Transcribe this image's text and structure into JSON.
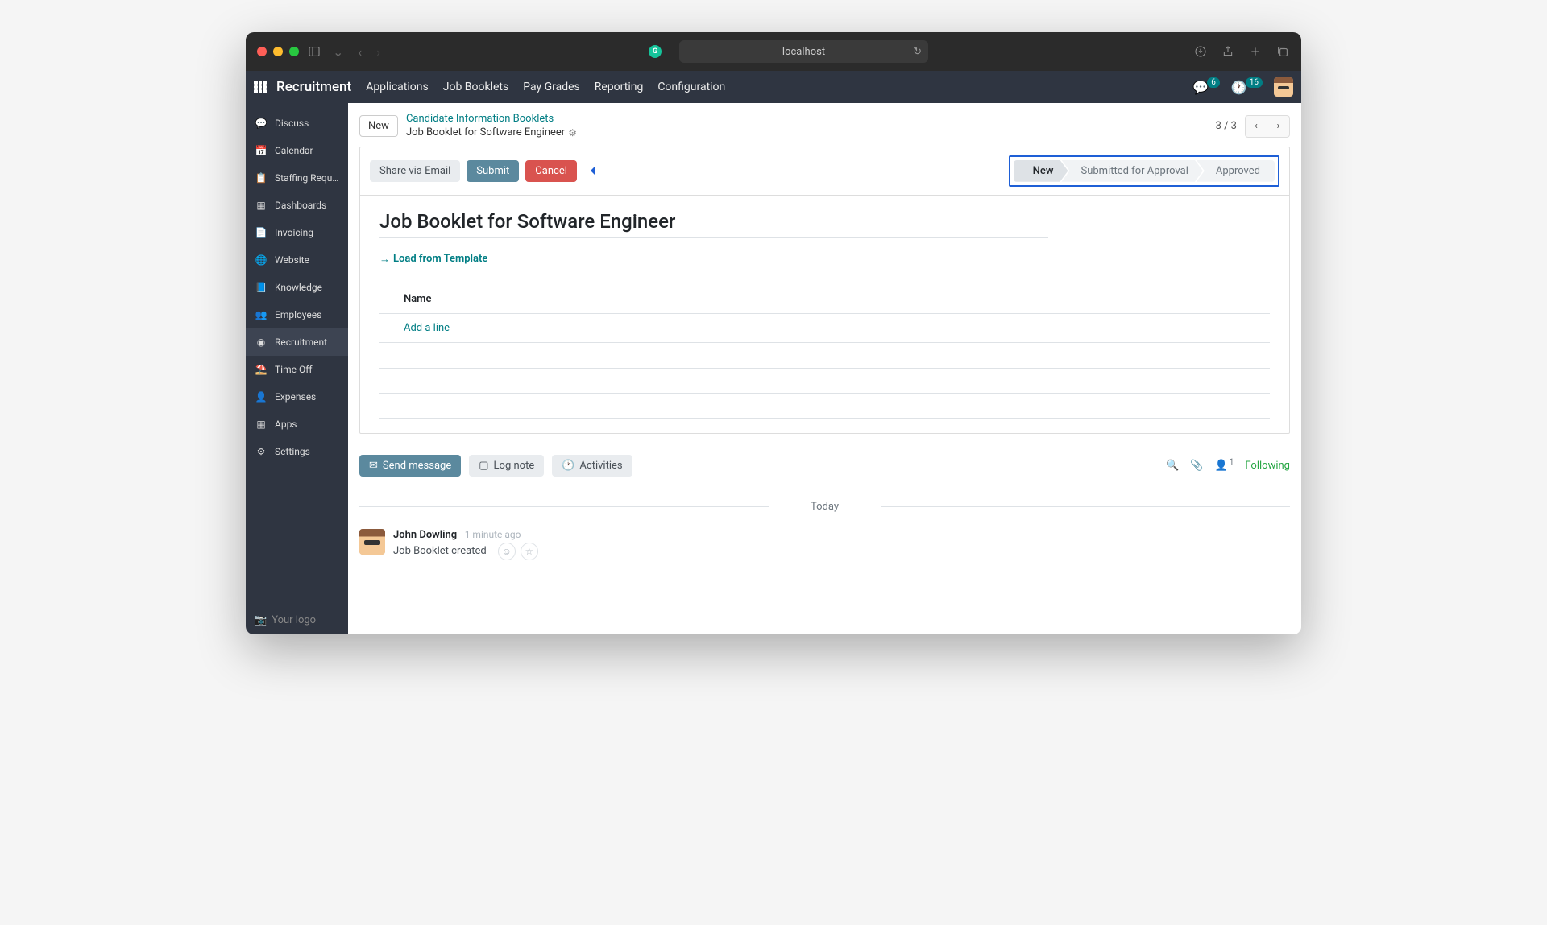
{
  "browser": {
    "url": "localhost"
  },
  "topnav": {
    "brand": "Recruitment",
    "items": [
      "Applications",
      "Job Booklets",
      "Pay Grades",
      "Reporting",
      "Configuration"
    ],
    "chat_badge": "6",
    "activity_badge": "16"
  },
  "sidebar": {
    "items": [
      {
        "label": "Discuss",
        "icon": "chat"
      },
      {
        "label": "Calendar",
        "icon": "calendar"
      },
      {
        "label": "Staffing Requ…",
        "icon": "clipboard"
      },
      {
        "label": "Dashboards",
        "icon": "grid"
      },
      {
        "label": "Invoicing",
        "icon": "invoice"
      },
      {
        "label": "Website",
        "icon": "globe"
      },
      {
        "label": "Knowledge",
        "icon": "book"
      },
      {
        "label": "Employees",
        "icon": "users"
      },
      {
        "label": "Recruitment",
        "icon": "person",
        "active": true
      },
      {
        "label": "Time Off",
        "icon": "umbrella"
      },
      {
        "label": "Expenses",
        "icon": "money"
      },
      {
        "label": "Apps",
        "icon": "apps"
      },
      {
        "label": "Settings",
        "icon": "gear"
      }
    ],
    "footer": "Your logo"
  },
  "breadcrumb": {
    "new_btn": "New",
    "parent": "Candidate Information Booklets",
    "current": "Job Booklet for Software Engineer",
    "pager": "3 / 3"
  },
  "actions": {
    "share": "Share via Email",
    "submit": "Submit",
    "cancel": "Cancel"
  },
  "status": {
    "steps": [
      "New",
      "Submitted for Approval",
      "Approved"
    ],
    "active_index": 0
  },
  "form": {
    "title": "Job Booklet for Software Engineer",
    "load_template": "Load from Template",
    "table_header": "Name",
    "add_line": "Add a line"
  },
  "chatter": {
    "send": "Send message",
    "log": "Log note",
    "activities": "Activities",
    "following": "Following",
    "follower_count": "1"
  },
  "thread": {
    "date": "Today",
    "author": "John Dowling",
    "time": "- 1 minute ago",
    "text": "Job Booklet created"
  }
}
